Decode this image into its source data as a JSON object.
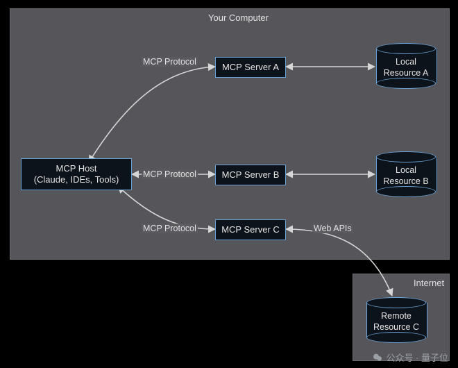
{
  "panels": {
    "outer": "Your Computer",
    "inner": "Internet"
  },
  "nodes": {
    "host": "MCP Host\n(Claude, IDEs, Tools)",
    "serverA": "MCP Server A",
    "serverB": "MCP Server B",
    "serverC": "MCP Server C"
  },
  "cylinders": {
    "resA": "Local\nResource A",
    "resB": "Local\nResource B",
    "resC": "Remote\nResource C"
  },
  "edges": {
    "protoA": "MCP Protocol",
    "protoB": "MCP Protocol",
    "protoC": "MCP Protocol",
    "webapis": "Web APIs"
  },
  "watermark": {
    "text": "公众号 · 量子位"
  },
  "colors": {
    "arrow": "#d6d6d6",
    "panel": "#55555a",
    "nodeFill": "#0d131a",
    "nodeStroke": "#6aa2d6"
  }
}
